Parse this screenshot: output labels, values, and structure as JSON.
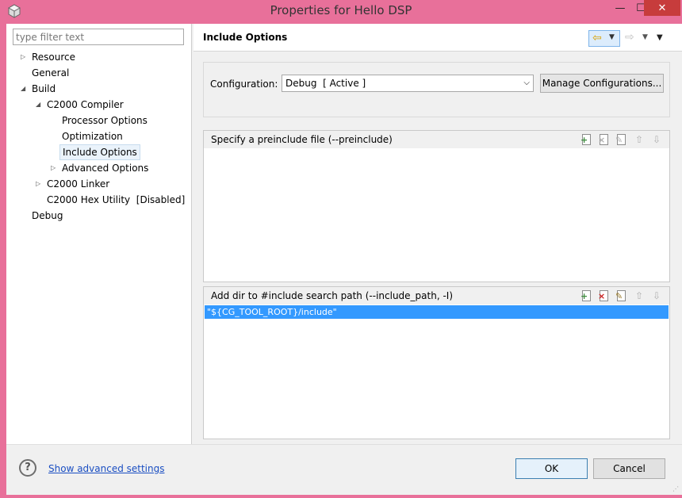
{
  "window": {
    "title": "Properties for Hello DSP",
    "close_glyph": "✕",
    "min_glyph": "—",
    "max_glyph": "☐"
  },
  "sidebar": {
    "filter_placeholder": "type filter text",
    "items": [
      {
        "label": "Resource",
        "level": 0,
        "twisty": "▷"
      },
      {
        "label": "General",
        "level": 0,
        "twisty": ""
      },
      {
        "label": "Build",
        "level": 0,
        "twisty": "◢"
      },
      {
        "label": "C2000 Compiler",
        "level": 1,
        "twisty": "◢"
      },
      {
        "label": "Processor Options",
        "level": 2,
        "twisty": ""
      },
      {
        "label": "Optimization",
        "level": 2,
        "twisty": ""
      },
      {
        "label": "Include Options",
        "level": 2,
        "twisty": "",
        "selected": true
      },
      {
        "label": "Advanced Options",
        "level": 2,
        "twisty": "▷"
      },
      {
        "label": "C2000 Linker",
        "level": 1,
        "twisty": "▷"
      },
      {
        "label": "C2000 Hex Utility  [Disabled]",
        "level": 1,
        "twisty": ""
      },
      {
        "label": "Debug",
        "level": 0,
        "twisty": ""
      }
    ]
  },
  "page": {
    "title": "Include Options",
    "back_glyph": "⇦",
    "forward_glyph": "⇨",
    "dropdown_glyph": "▼"
  },
  "config": {
    "label": "Configuration:",
    "value": "Debug  [ Active ]",
    "manage_label": "Manage Configurations..."
  },
  "preinclude": {
    "title": "Specify a preinclude file (--preinclude)",
    "items": []
  },
  "include_path": {
    "title": "Add dir to #include search path (--include_path, -I)",
    "items": [
      "\"${CG_TOOL_ROOT}/include\""
    ]
  },
  "toolbar_icons": {
    "add": "add-icon",
    "delete": "delete-icon",
    "edit": "edit-icon",
    "move_up": "move-up-icon",
    "move_down": "move-down-icon"
  },
  "footer": {
    "help_glyph": "?",
    "advanced_link": "Show advanced settings",
    "ok_label": "OK",
    "cancel_label": "Cancel"
  },
  "colors": {
    "window_frame": "#e8709a",
    "selection": "#3399ff",
    "link": "#1a4ec2",
    "close_button": "#c73c3c"
  }
}
